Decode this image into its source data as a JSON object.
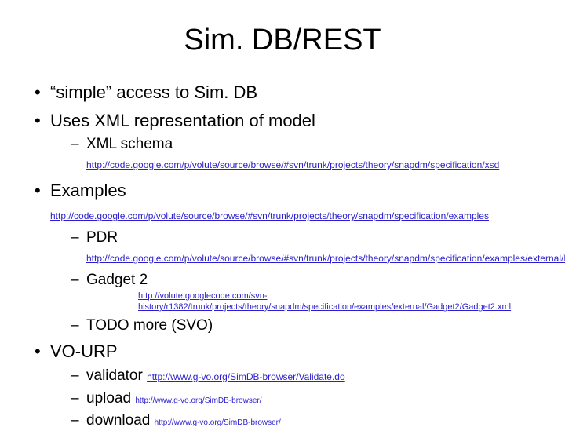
{
  "title": "Sim. DB/REST",
  "b1": {
    "text": "“simple” access to Sim. DB"
  },
  "b2": {
    "text": "Uses XML representation of model"
  },
  "b2a": {
    "label": "XML schema ",
    "url": "http://code.google.com/p/volute/source/browse/#svn/trunk/projects/theory/snapdm/specification/xsd"
  },
  "b3": {
    "label": "Examples ",
    "url": "http://code.google.com/p/volute/source/browse/#svn/trunk/projects/theory/snapdm/specification/examples"
  },
  "b3a": {
    "label": "PDR ",
    "url": "http://code.google.com/p/volute/source/browse/#svn/trunk/projects/theory/snapdm/specification/examples/external/PDR"
  },
  "b3b": {
    "label": "Gadget 2"
  },
  "b3b_url": "http://volute.googlecode.com/svn-history/r1382/trunk/projects/theory/snapdm/specification/examples/external/Gadget2/Gadget2.xml",
  "b3c": {
    "label": "TODO more (SVO)"
  },
  "b4": {
    "text": "VO-URP"
  },
  "b4a": {
    "label": "validator ",
    "url": "http://www.g-vo.org/SimDB-browser/Validate.do"
  },
  "b4b": {
    "label": "upload ",
    "url": "http://www.g-vo.org/SimDB-browser/"
  },
  "b4c": {
    "label": "download ",
    "url": "http://www.g-vo.org/SimDB-browser/"
  }
}
